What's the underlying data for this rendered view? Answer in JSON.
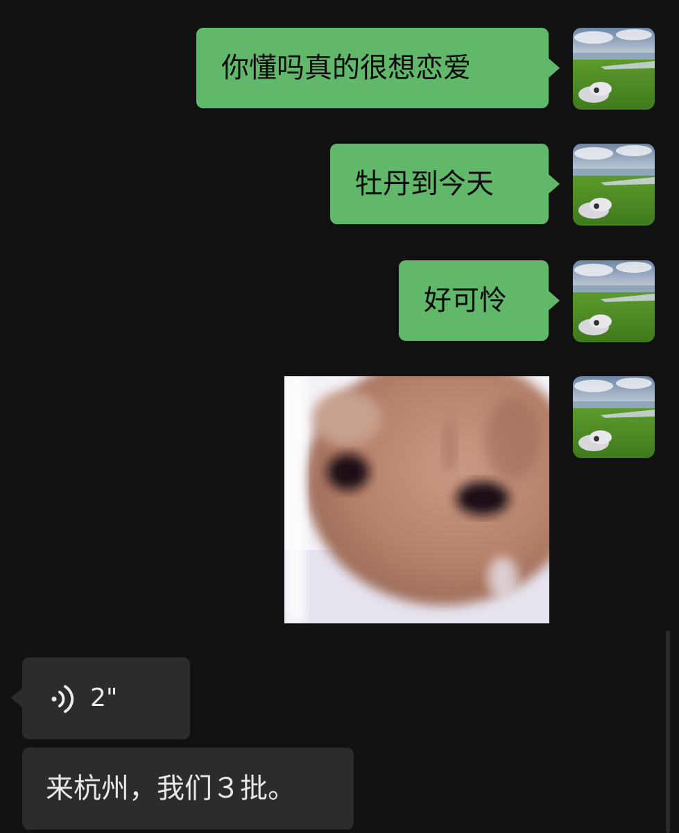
{
  "messages": {
    "m1": {
      "text": "你懂吗真的很想恋爱"
    },
    "m2": {
      "text": "牡丹到今天"
    },
    "m3": {
      "text": "好可怜"
    },
    "voice": {
      "duration": "2\""
    },
    "m5": {
      "text": "来杭州，我们３批。"
    }
  },
  "icons": {
    "voice": "voice-wave-icon",
    "avatar": "avatar-image",
    "sticker": "crying-kitten-sticker"
  },
  "colors": {
    "background": "#111111",
    "sent_bubble": "#62b86a",
    "received_bubble": "#2c2c2c"
  }
}
